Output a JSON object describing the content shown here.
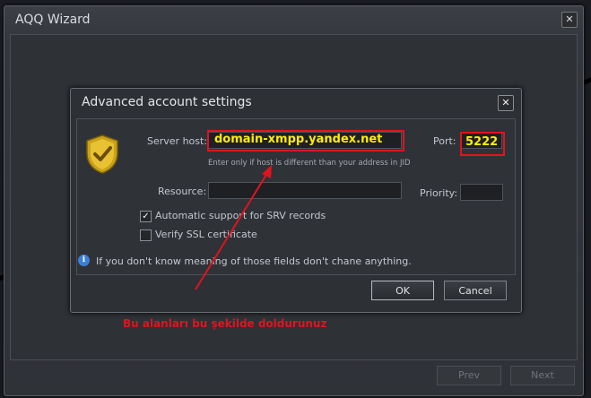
{
  "wizard": {
    "title": "AQQ Wizard",
    "close_icon": "close-icon",
    "prev_label": "Prev",
    "next_label": "Next"
  },
  "dialog": {
    "title": "Advanced account settings",
    "close_icon": "close-icon",
    "shield_icon": "shield-check-icon",
    "server_host_label": "Server host:",
    "server_host_value": "domain-xmpp.yandex.net",
    "server_host_hint": "Enter only if host is different than your address in JID",
    "port_label": "Port:",
    "port_value": "5222",
    "resource_label": "Resource:",
    "resource_value": "",
    "priority_label": "Priority:",
    "priority_value": "",
    "srv_label": "Automatic support for SRV records",
    "srv_checked": true,
    "ssl_label": "Verify SSL certificate",
    "ssl_checked": false,
    "info_text": "If you don't know meaning of those fields don't chane anything.",
    "ok_label": "OK",
    "cancel_label": "Cancel"
  },
  "annotation": {
    "text": "Bu alanları bu şekilde doldurunuz",
    "color": "#e0141e",
    "highlight_color": "#e0141e",
    "value_color": "#ffee00"
  }
}
